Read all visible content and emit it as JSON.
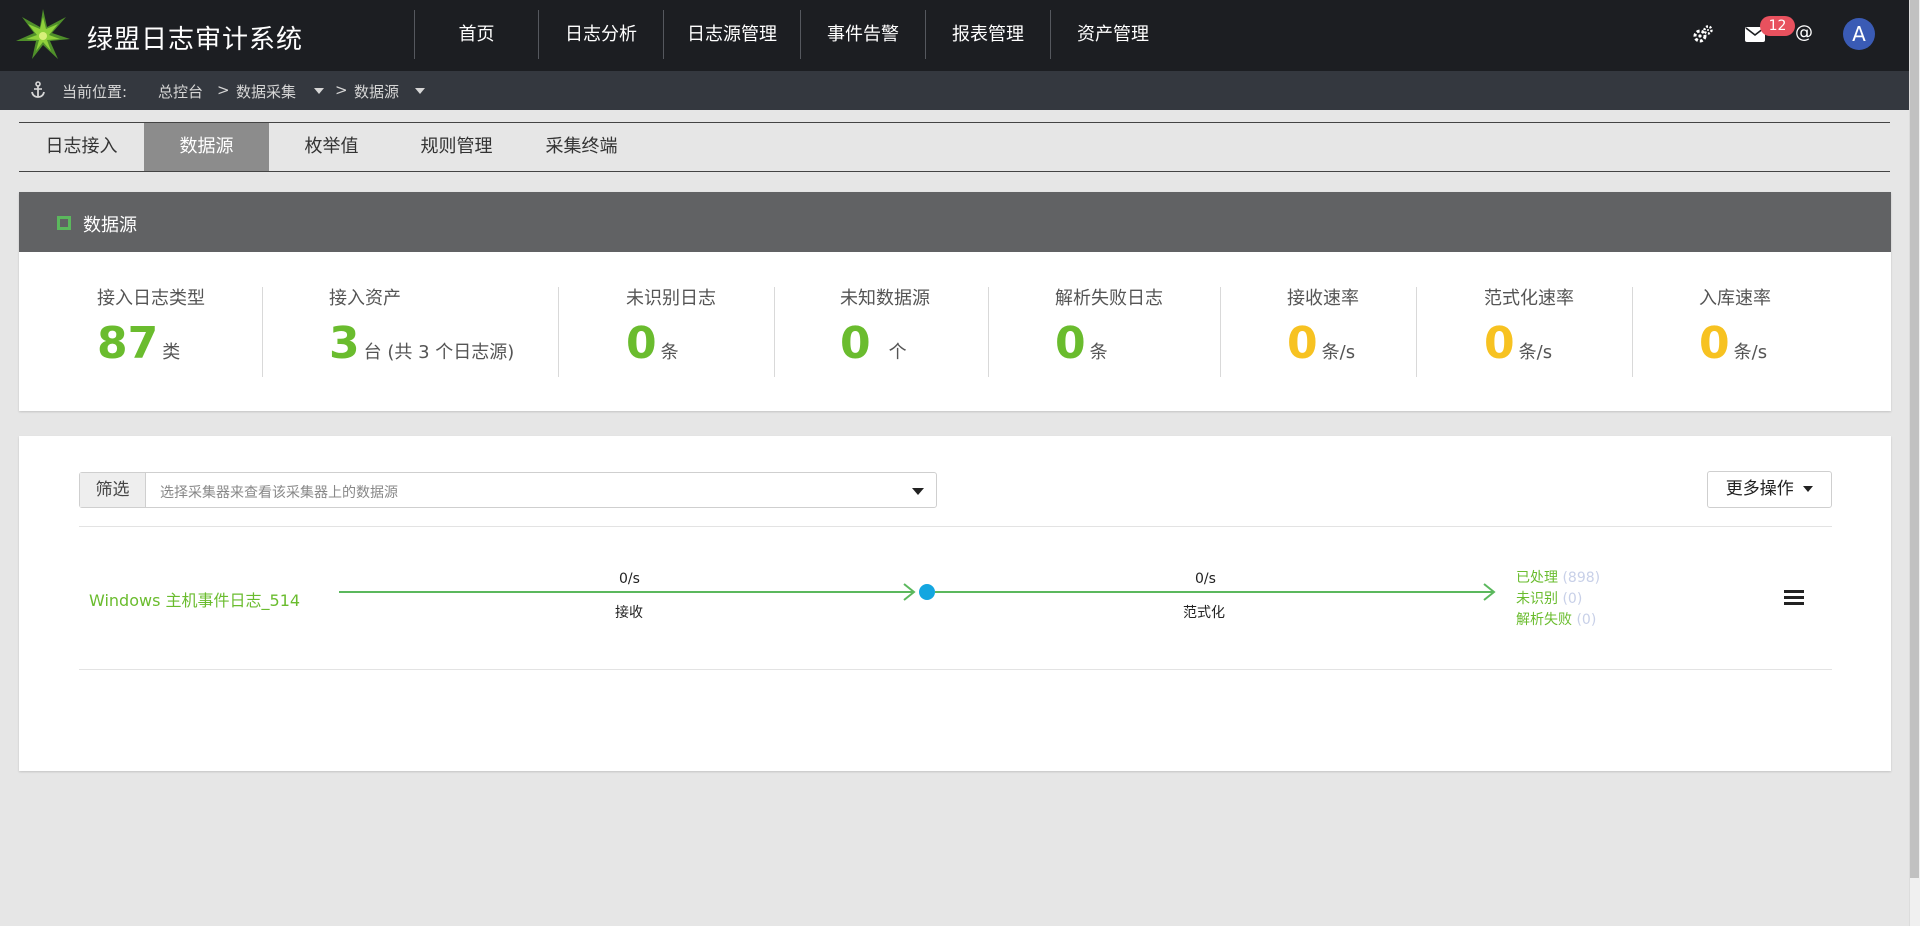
{
  "app": {
    "title": "绿盟日志审计系统"
  },
  "nav": {
    "items": [
      {
        "label": "首页"
      },
      {
        "label": "日志分析"
      },
      {
        "label": "日志源管理"
      },
      {
        "label": "事件告警"
      },
      {
        "label": "报表管理"
      },
      {
        "label": "资产管理"
      }
    ]
  },
  "toolbar": {
    "settings_icon": "gears-icon",
    "mail_icon": "envelope-icon",
    "mail_badge": "12",
    "at_symbol": "@",
    "avatar_letter": "A"
  },
  "breadcrumb": {
    "prefix": "当前位置:",
    "items": [
      "总控台",
      "数据采集",
      "数据源"
    ],
    "separator": ">"
  },
  "tabs": [
    {
      "label": "日志接入",
      "active": false
    },
    {
      "label": "数据源",
      "active": true
    },
    {
      "label": "枚举值",
      "active": false
    },
    {
      "label": "规则管理",
      "active": false
    },
    {
      "label": "采集终端",
      "active": false
    }
  ],
  "stats_panel": {
    "title": "数据源",
    "stats": [
      {
        "label": "接入日志类型",
        "value": "87",
        "unit": "类",
        "color": "#6abc2e"
      },
      {
        "label": "接入资产",
        "value": "3",
        "unit": "台 (共 3 个日志源)",
        "color": "#6abc2e"
      },
      {
        "label": "未识别日志",
        "value": "0",
        "unit": "条",
        "color": "#6abc2e"
      },
      {
        "label": "未知数据源",
        "value": "0",
        "unit": "个",
        "color": "#6abc2e"
      },
      {
        "label": "解析失败日志",
        "value": "0",
        "unit": "条",
        "color": "#6abc2e"
      },
      {
        "label": "接收速率",
        "value": "0",
        "unit": "条/s",
        "color": "#f7c221"
      },
      {
        "label": "范式化速率",
        "value": "0",
        "unit": "条/s",
        "color": "#f7c221"
      },
      {
        "label": "入库速率",
        "value": "0",
        "unit": "条/s",
        "color": "#f7c221"
      }
    ]
  },
  "source_panel": {
    "filter_label": "筛选",
    "filter_placeholder": "选择采集器来查看该采集器上的数据源",
    "more_button": "更多操作",
    "rows": [
      {
        "name": "Windows 主机事件日志_514",
        "receive_rate": "0/s",
        "receive_label": "接收",
        "normalize_rate": "0/s",
        "normalize_label": "范式化",
        "processed_label": "已处理",
        "processed_count": "(898)",
        "unrecognized_label": "未识别",
        "unrecognized_count": "(0)",
        "failed_label": "解析失败",
        "failed_count": "(0)"
      }
    ]
  }
}
